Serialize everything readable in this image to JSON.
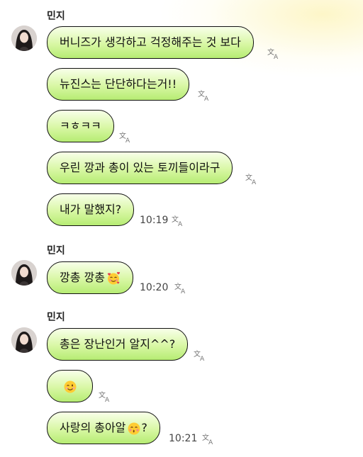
{
  "messages": [
    {
      "sender": "민지",
      "texts": [
        "버니즈가 생각하고 걱정해주는 것 보다",
        "뉴진스는 단단하다는거!!",
        "ㅋㅎㅋㅋ",
        "우린 깡과 총이 있는 토끼들이라구",
        "내가 말했지?"
      ],
      "time": "10:19"
    },
    {
      "sender": "민지",
      "texts": [
        "깡총 깡총"
      ],
      "emojis": [
        "smiling-face-with-hearts"
      ],
      "time": "10:20"
    },
    {
      "sender": "민지",
      "texts": [
        "총은 장난인거 알지^^?",
        "",
        "사랑의 총아알",
        "?"
      ],
      "emojis": [
        "winking-face",
        "kissing-face"
      ],
      "time": "10:21"
    }
  ],
  "colors": {
    "bubble_top": "#f8ffe9",
    "bubble_bottom": "#b6ec73",
    "bubble_border": "#111111"
  }
}
